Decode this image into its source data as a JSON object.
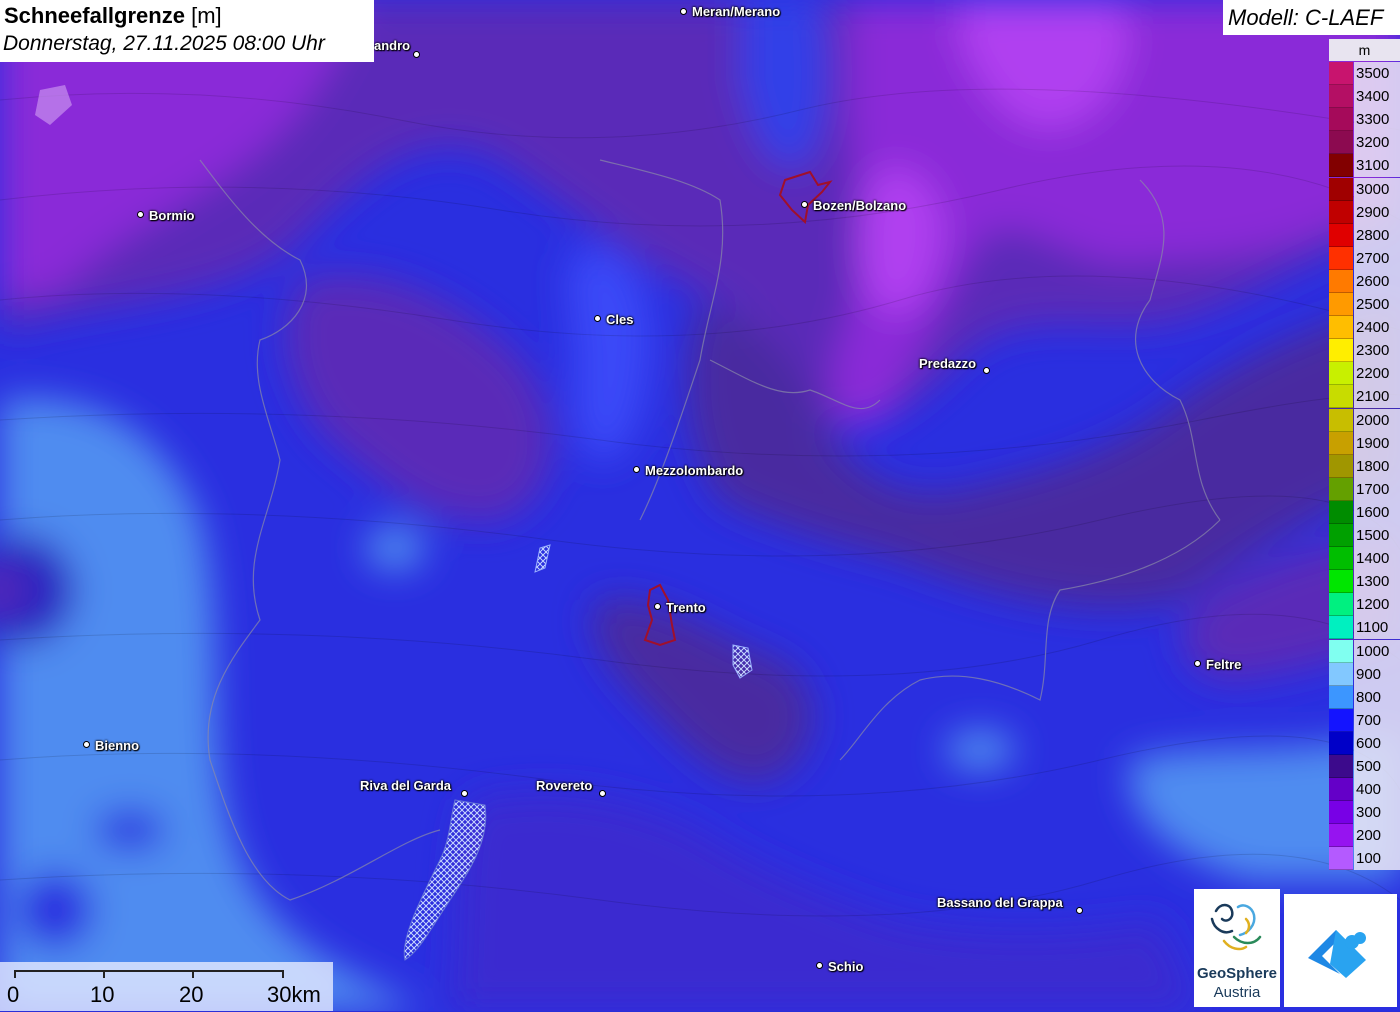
{
  "title": {
    "main": "Schneefallgrenze",
    "unit": "[m]",
    "date": "Donnerstag, 27.11.2025 08:00 Uhr"
  },
  "model": "Modell: C-LAEF",
  "legend": {
    "unit": "m",
    "entries": [
      {
        "label": "3500",
        "color": "#c8146e"
      },
      {
        "label": "3400",
        "color": "#b40f64"
      },
      {
        "label": "3300",
        "color": "#a50a5a"
      },
      {
        "label": "3200",
        "color": "#8c0a50"
      },
      {
        "label": "3100",
        "color": "#820000"
      },
      {
        "label": "3000",
        "color": "#a00000"
      },
      {
        "label": "2900",
        "color": "#c00000"
      },
      {
        "label": "2800",
        "color": "#e00000"
      },
      {
        "label": "2700",
        "color": "#ff3000"
      },
      {
        "label": "2600",
        "color": "#ff7a00"
      },
      {
        "label": "2500",
        "color": "#ff9a00"
      },
      {
        "label": "2400",
        "color": "#ffbe00"
      },
      {
        "label": "2300",
        "color": "#ffee00"
      },
      {
        "label": "2200",
        "color": "#c8f000"
      },
      {
        "label": "2100",
        "color": "#c8dc00"
      },
      {
        "label": "2000",
        "color": "#c8be00"
      },
      {
        "label": "1900",
        "color": "#c8a000"
      },
      {
        "label": "1800",
        "color": "#a09600"
      },
      {
        "label": "1700",
        "color": "#64a000"
      },
      {
        "label": "1600",
        "color": "#008c00"
      },
      {
        "label": "1500",
        "color": "#00a000"
      },
      {
        "label": "1400",
        "color": "#00be00"
      },
      {
        "label": "1300",
        "color": "#00e600"
      },
      {
        "label": "1200",
        "color": "#00f080"
      },
      {
        "label": "1100",
        "color": "#00f0c0"
      },
      {
        "label": "1000",
        "color": "#80fff0"
      },
      {
        "label": "900",
        "color": "#82c8ff"
      },
      {
        "label": "800",
        "color": "#3c96ff"
      },
      {
        "label": "700",
        "color": "#1414ff"
      },
      {
        "label": "600",
        "color": "#0000c8"
      },
      {
        "label": "500",
        "color": "#3c0a8c"
      },
      {
        "label": "400",
        "color": "#6400c8"
      },
      {
        "label": "300",
        "color": "#7800e6"
      },
      {
        "label": "200",
        "color": "#9614f0"
      },
      {
        "label": "100",
        "color": "#b45aff"
      }
    ]
  },
  "cities": [
    {
      "name": "Meran/Merano"
    },
    {
      "name": "andro"
    },
    {
      "name": "Bormio"
    },
    {
      "name": "Bozen/Bolzano"
    },
    {
      "name": "Cles"
    },
    {
      "name": "Predazzo"
    },
    {
      "name": "Mezzolombardo"
    },
    {
      "name": "Trento"
    },
    {
      "name": "Feltre"
    },
    {
      "name": "Bienno"
    },
    {
      "name": "Riva del Garda"
    },
    {
      "name": "Rovereto"
    },
    {
      "name": "Bassano del Grappa"
    },
    {
      "name": "Schio"
    }
  ],
  "scale": {
    "labels": [
      "0",
      "10",
      "20",
      "30km"
    ]
  },
  "logos": {
    "geosphere_line1": "GeoSphere",
    "geosphere_line2": "Austria"
  }
}
